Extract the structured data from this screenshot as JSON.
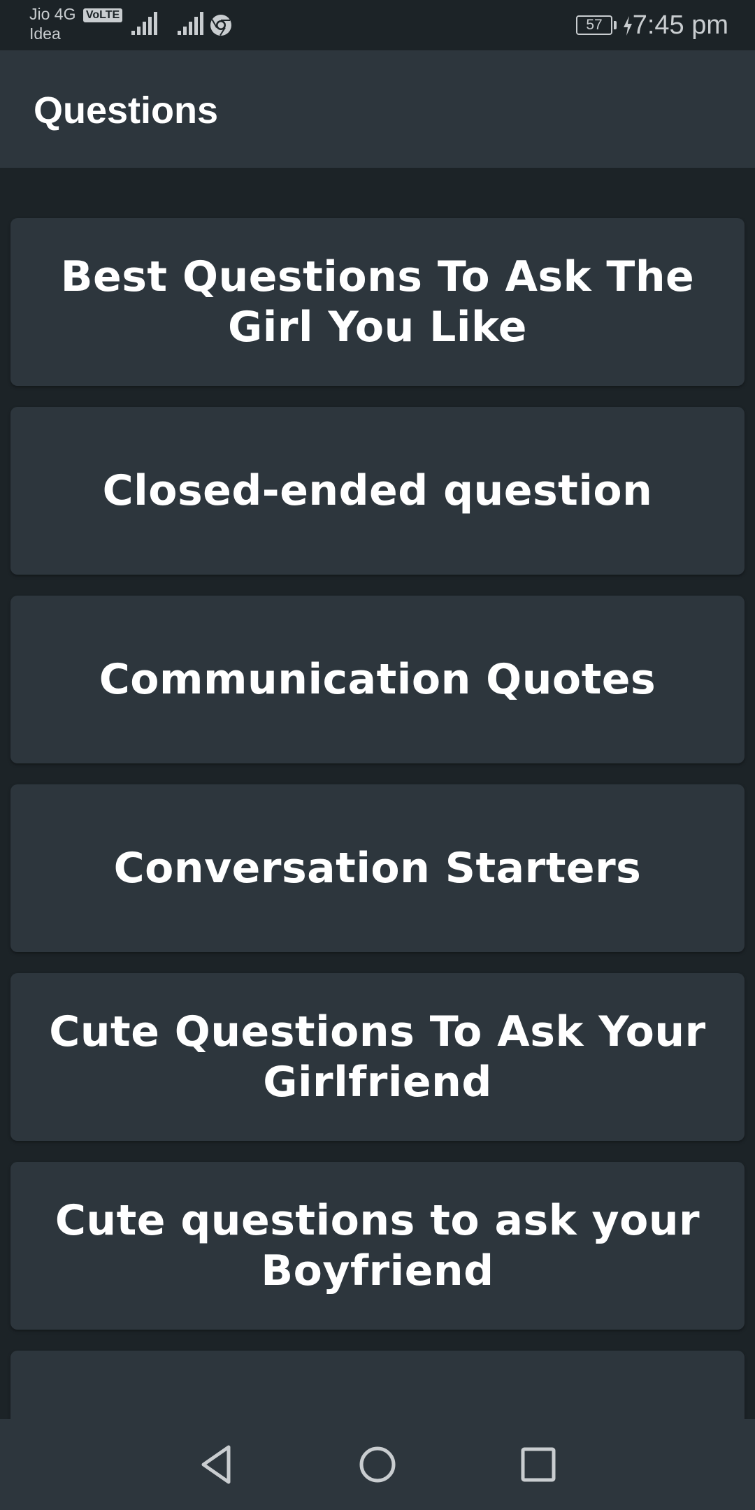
{
  "status_bar": {
    "carrier_primary": "Jio 4G",
    "volte": "VoLTE",
    "carrier_secondary": "Idea",
    "battery_level": "57",
    "time": "7:45 pm",
    "icons": [
      "signal-icon",
      "signal-icon",
      "chrome-icon",
      "battery-icon",
      "charging-bolt-icon"
    ]
  },
  "app_bar": {
    "title": "Questions"
  },
  "categories": [
    {
      "label": "Best Questions To Ask The Girl You Like"
    },
    {
      "label": "Closed-ended question"
    },
    {
      "label": "Communication Quotes"
    },
    {
      "label": "Conversation Starters"
    },
    {
      "label": "Cute Questions To Ask Your Girlfriend"
    },
    {
      "label": "Cute questions to ask your Boyfriend"
    },
    {
      "label": ""
    }
  ],
  "nav_bar": {
    "icons": [
      "back-icon",
      "home-icon",
      "recents-icon"
    ]
  },
  "colors": {
    "background": "#1c2327",
    "surface": "#2d363d",
    "text": "#ffffff",
    "status_text": "#c9cdd0"
  }
}
